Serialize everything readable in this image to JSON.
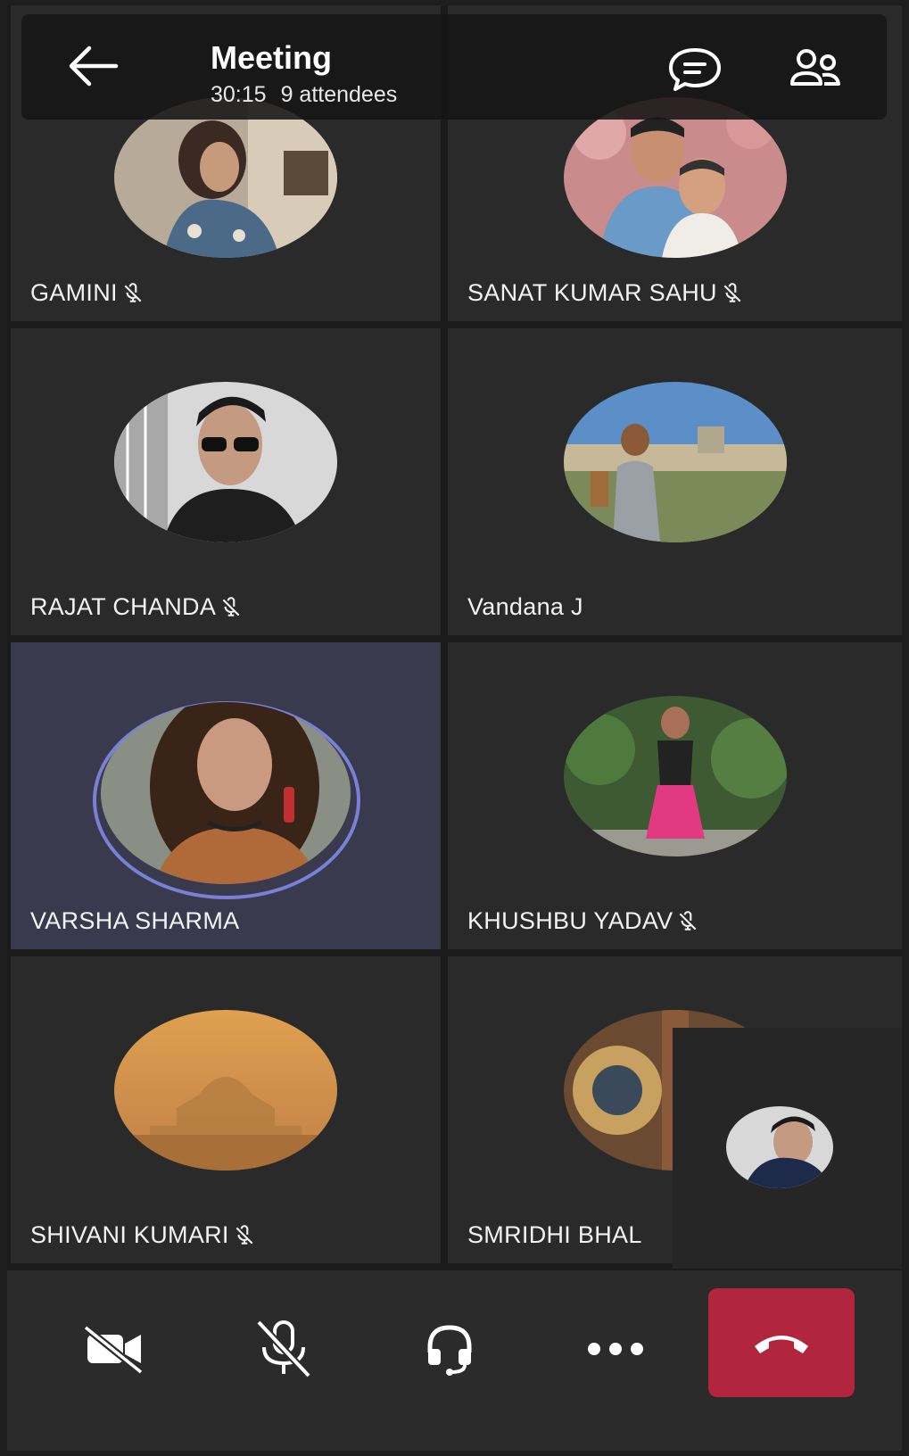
{
  "header": {
    "title": "Meeting",
    "duration": "30:15",
    "attendees": "9 attendees"
  },
  "participants": [
    {
      "name": "GAMINI",
      "muted": true
    },
    {
      "name": "SANAT KUMAR SAHU",
      "muted": true
    },
    {
      "name": "RAJAT CHANDA",
      "muted": true
    },
    {
      "name": "Vandana J",
      "muted": false
    },
    {
      "name": "VARSHA SHARMA",
      "muted": false,
      "speaking": true
    },
    {
      "name": "KHUSHBU YADAV",
      "muted": true
    },
    {
      "name": "SHIVANI KUMARI",
      "muted": true
    },
    {
      "name": "SMRIDHI BHAL",
      "muted": false
    }
  ],
  "controls": [
    "camera-off-icon",
    "mic-off-icon",
    "headset-icon",
    "more-icon",
    "hang-up-icon"
  ],
  "colors": {
    "accent": "#7b7fd6",
    "hangup": "#b1253d",
    "tile": "#2a2a2a",
    "active_tile": "#3a3a4f"
  }
}
